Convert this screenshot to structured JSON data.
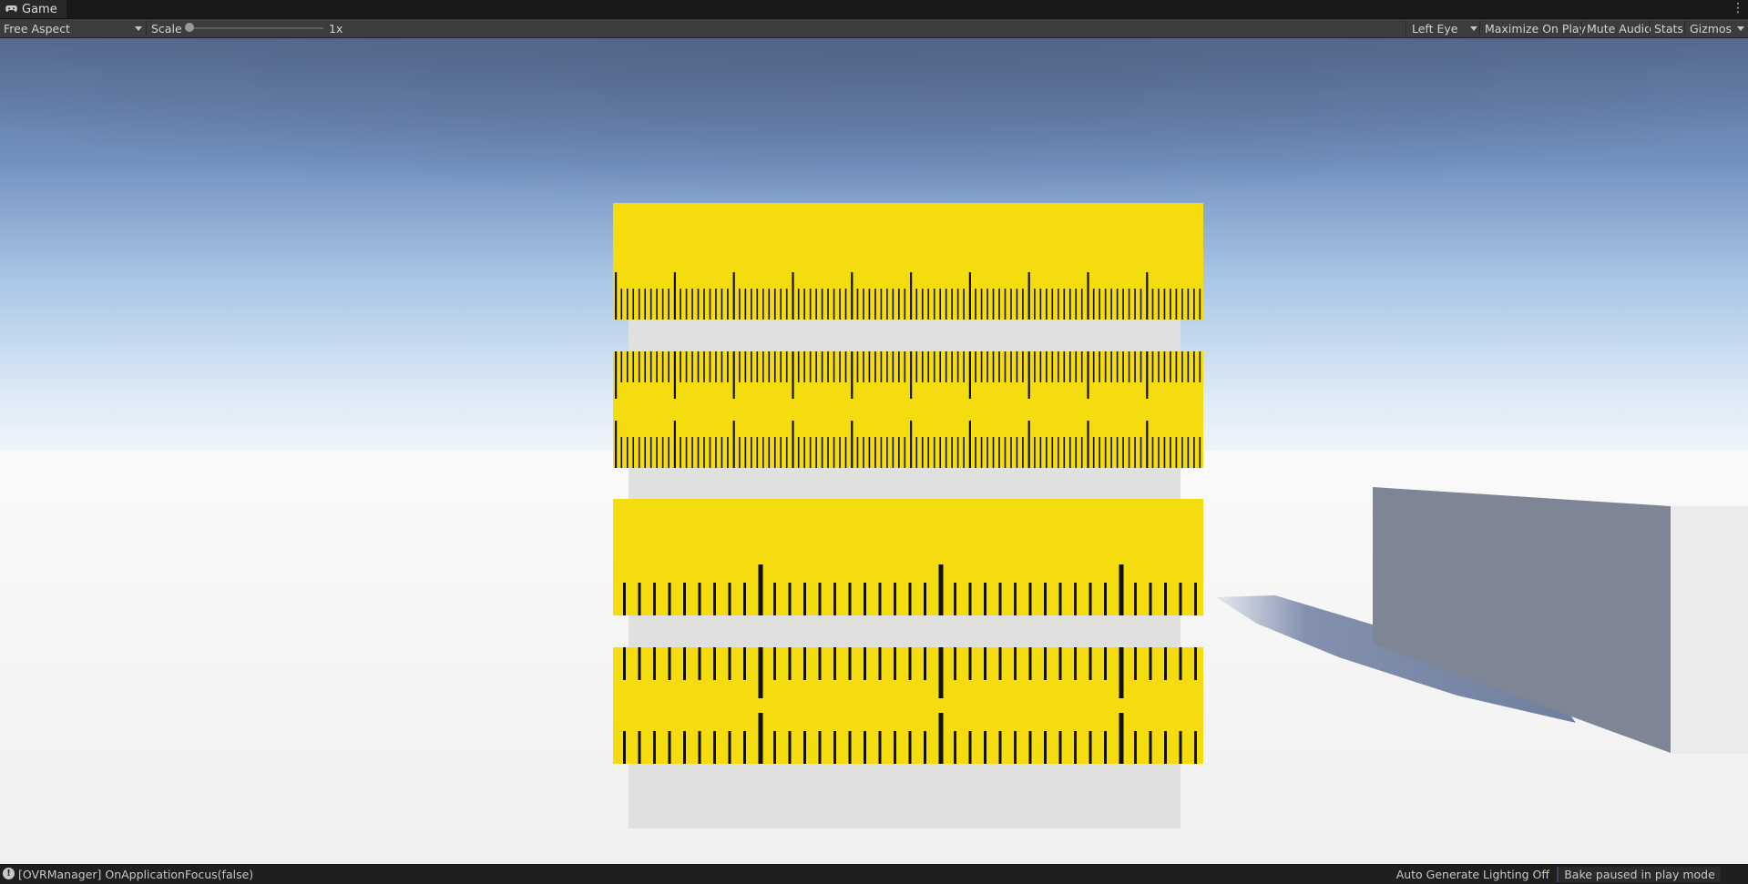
{
  "window": {
    "tab_title": "Game",
    "more_glyph": "⋮"
  },
  "toolbar": {
    "aspect": "Free Aspect",
    "scale_label": "Scale",
    "scale_value": "1x",
    "scale_level": 0,
    "eye": "Left Eye",
    "maximize_on_play": "Maximize On Play",
    "mute_audio": "Mute Audio",
    "stats": "Stats",
    "gizmos": "Gizmos"
  },
  "status": {
    "icon_glyph": "!",
    "message": "[OVRManager] OnApplicationFocus(false)",
    "lighting": "Auto Generate Lighting Off",
    "bake": "Bake paused in play mode"
  },
  "scene": {
    "sky_top": "#566a90",
    "horizon": "#eef4fa",
    "ground": "#f6f6f6",
    "ruler_color": "#f4dc0e",
    "tick_color": "#111111",
    "stand_color": "#e0e0de",
    "box_side_color": "#7e8696",
    "box_face_color": "#ebebeb",
    "shadow_color": "#7685a6"
  }
}
